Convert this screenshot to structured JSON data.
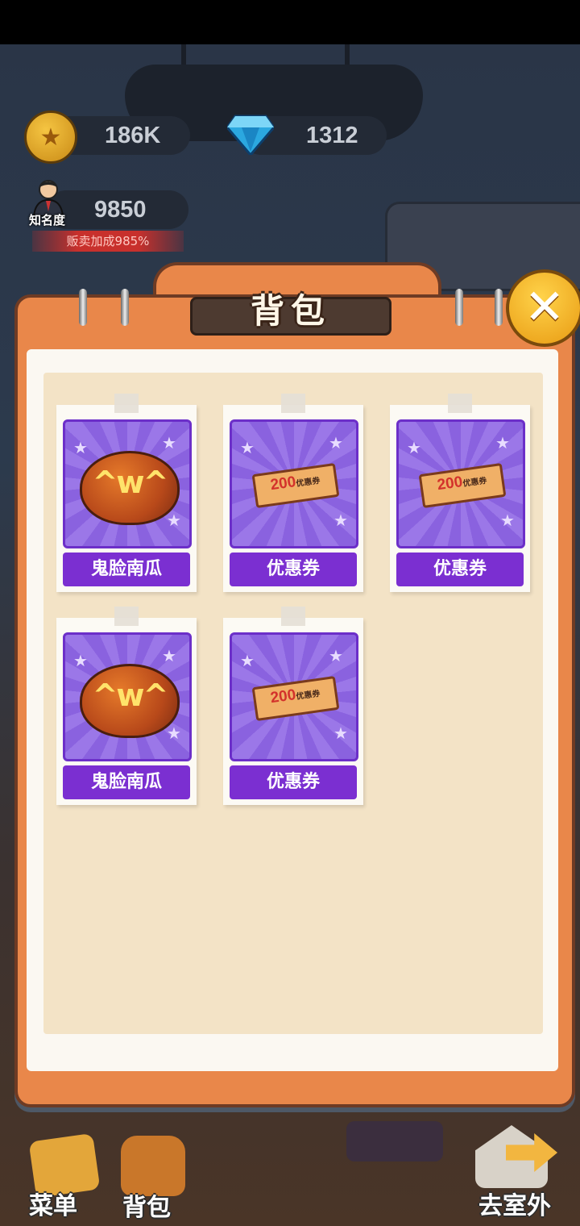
{
  "hud": {
    "coins": "186K",
    "gems": "1312",
    "fame_value": "9850",
    "fame_label": "知名度",
    "bonus_text": "贩卖加成985%"
  },
  "panel": {
    "title": "背包",
    "close_symbol": "✕"
  },
  "items": [
    {
      "name": "鬼脸南瓜",
      "icon": "pumpkin-icon"
    },
    {
      "name": "优惠券",
      "icon": "coupon-icon",
      "ticket_value": "200",
      "ticket_text": "优惠券"
    },
    {
      "name": "优惠券",
      "icon": "coupon-icon",
      "ticket_value": "200",
      "ticket_text": "优惠券"
    },
    {
      "name": "鬼脸南瓜",
      "icon": "pumpkin-icon"
    },
    {
      "name": "优惠券",
      "icon": "coupon-icon",
      "ticket_value": "200",
      "ticket_text": "优惠券"
    }
  ],
  "nav": {
    "menu": "菜单",
    "bag": "背包",
    "outdoor": "去室外"
  },
  "colors": {
    "panel_orange": "#e9874a",
    "label_purple": "#7b2fd1",
    "paper": "#f3e3c6"
  }
}
